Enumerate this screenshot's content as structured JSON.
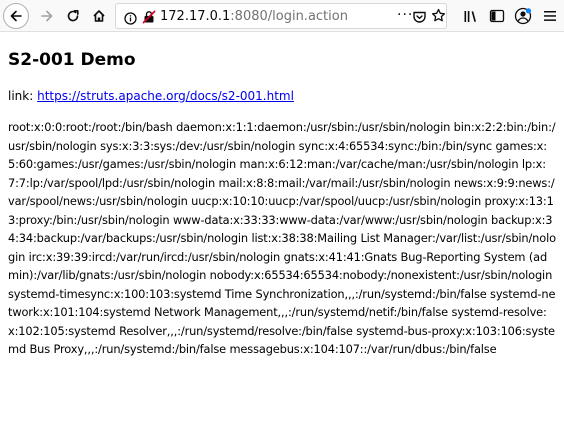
{
  "browser": {
    "url_host": "172.17.0.1",
    "url_rest": ":8080/login.action",
    "more_label": "···",
    "icons": {
      "back": "back-arrow-icon",
      "forward": "forward-arrow-icon",
      "reload": "reload-icon",
      "home": "home-icon",
      "info": "info-icon",
      "insecure": "insecure-lock-icon",
      "pocket": "pocket-icon",
      "star": "bookmark-star-icon",
      "library": "library-icon",
      "sidebar": "sidebar-icon",
      "account": "account-icon",
      "menu": "hamburger-menu-icon"
    },
    "colors": {
      "toolbar_bg": "#f9f9fa",
      "link": "#0000ee",
      "insecure": "#d70022"
    }
  },
  "page": {
    "title": "S2-001 Demo",
    "link_prefix": "link: ",
    "link_text": "https://struts.apache.org/docs/s2-001.html",
    "output": "root:x:0:0:root:/root:/bin/bash daemon:x:1:1:daemon:/usr/sbin:/usr/sbin/nologin bin:x:2:2:bin:/bin:/usr/sbin/nologin sys:x:3:3:sys:/dev:/usr/sbin/nologin sync:x:4:65534:sync:/bin:/bin/sync games:x:5:60:games:/usr/games:/usr/sbin/nologin man:x:6:12:man:/var/cache/man:/usr/sbin/nologin lp:x:7:7:lp:/var/spool/lpd:/usr/sbin/nologin mail:x:8:8:mail:/var/mail:/usr/sbin/nologin news:x:9:9:news:/var/spool/news:/usr/sbin/nologin uucp:x:10:10:uucp:/var/spool/uucp:/usr/sbin/nologin proxy:x:13:13:proxy:/bin:/usr/sbin/nologin www-data:x:33:33:www-data:/var/www:/usr/sbin/nologin backup:x:34:34:backup:/var/backups:/usr/sbin/nologin list:x:38:38:Mailing List Manager:/var/list:/usr/sbin/nologin irc:x:39:39:ircd:/var/run/ircd:/usr/sbin/nologin gnats:x:41:41:Gnats Bug-Reporting System (admin):/var/lib/gnats:/usr/sbin/nologin nobody:x:65534:65534:nobody:/nonexistent:/usr/sbin/nologin systemd-timesync:x:100:103:systemd Time Synchronization,,,:/run/systemd:/bin/false systemd-network:x:101:104:systemd Network Management,,,:/run/systemd/netif:/bin/false systemd-resolve:x:102:105:systemd Resolver,,,:/run/systemd/resolve:/bin/false systemd-bus-proxy:x:103:106:systemd Bus Proxy,,,:/run/systemd:/bin/false messagebus:x:104:107::/var/run/dbus:/bin/false"
  }
}
